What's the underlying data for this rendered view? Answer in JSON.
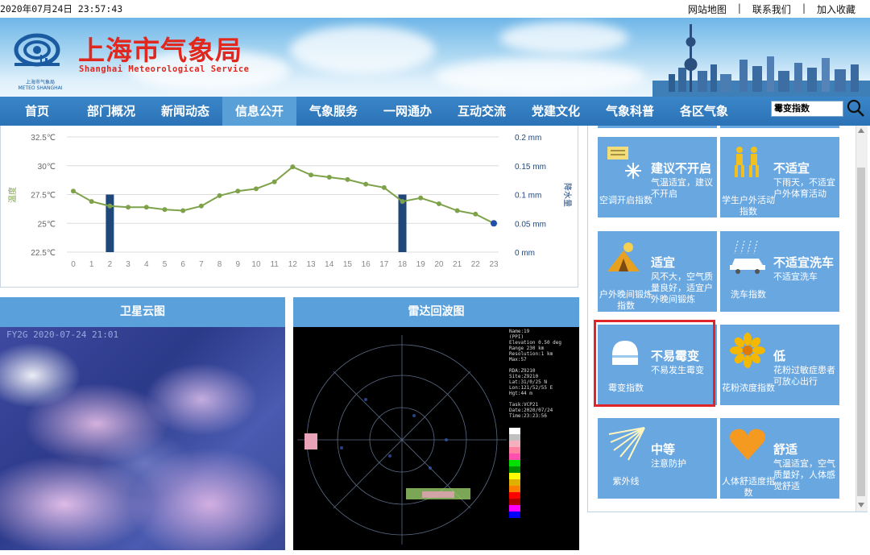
{
  "datetime": "2020年07月24日 23:57:43",
  "top_links": [
    "网站地图",
    "联系我们",
    "加入收藏"
  ],
  "site": {
    "title_cn": "上海市气象局",
    "title_en": "Shanghai Meteorological Service",
    "logo_caption": "上海市气象局\nMETEO SHANGHAI"
  },
  "nav": [
    "首页",
    "部门概况",
    "新闻动态",
    "信息公开",
    "气象服务",
    "一网通办",
    "互动交流",
    "党建文化",
    "气象科普",
    "各区气象"
  ],
  "nav_active": "信息公开",
  "search": {
    "value": "霉变指数"
  },
  "chart_data": {
    "type": "line+bar",
    "x": [
      0,
      1,
      2,
      3,
      4,
      5,
      6,
      7,
      8,
      9,
      10,
      11,
      12,
      13,
      14,
      15,
      16,
      17,
      18,
      19,
      20,
      21,
      22,
      23
    ],
    "left_axis": {
      "label": "温度",
      "ticks": [
        "22.5℃",
        "25℃",
        "27.5℃",
        "30℃",
        "32.5℃"
      ],
      "range": [
        22.5,
        32.5
      ]
    },
    "right_axis": {
      "label": "降水量",
      "ticks": [
        "0 mm",
        "0.05 mm",
        "0.1 mm",
        "0.15 mm",
        "0.2 mm"
      ],
      "range": [
        0,
        0.2
      ]
    },
    "temperature": [
      27.8,
      26.9,
      26.5,
      26.4,
      26.4,
      26.2,
      26.1,
      26.5,
      27.4,
      27.8,
      28.0,
      28.6,
      29.9,
      29.2,
      29.0,
      28.8,
      28.4,
      28.1,
      26.9,
      27.2,
      26.7,
      26.1,
      25.8,
      25.0
    ],
    "precipitation": [
      0,
      0,
      0.1,
      0,
      0,
      0,
      0,
      0,
      0,
      0,
      0,
      0,
      0,
      0,
      0,
      0,
      0,
      0,
      0.1,
      0,
      0,
      0,
      0,
      0
    ],
    "colors": {
      "line": "#7ea24a",
      "bar": "#1f477a",
      "last_point": "#1f4fa6"
    }
  },
  "panels": {
    "satellite": "卫星云图",
    "radar": "雷达回波图"
  },
  "satellite_stamp": "FY2G  2020-07-24 21:01",
  "radar_info": "Name:19\n(PPI)\nElevation 0.50 deg\nRange 230 km\nResolution:1 km\nMax:57\n\nRDA:Z9210\nSite:Z9210\nLat:31/0/25 N\nLon:121/52/55 E\nHgt:44 m\n\nTask:VCP21\nDate:2020/07/24\nTime:23:23:56",
  "indices": [
    {
      "icon": "ac-icon",
      "level": "建议不开启",
      "desc": "气温适宜，建议不开启",
      "name": "空调开启指数"
    },
    {
      "icon": "hikers-icon",
      "level": "不适宜",
      "desc": "下雨天，不适宜户外体育活动",
      "name": "学生户外活动指数"
    },
    {
      "icon": "tent-icon",
      "level": "适宜",
      "desc": "风不大，空气质量良好，适宜户外晚间锻炼",
      "name": "户外晚间锻炼指数"
    },
    {
      "icon": "car-wash-icon",
      "level": "不适宜洗车",
      "desc": "不适宜洗车",
      "name": "洗车指数"
    },
    {
      "icon": "bread-icon",
      "level": "不易霉变",
      "desc": "不易发生霉变",
      "name": "霉变指数"
    },
    {
      "icon": "flower-icon",
      "level": "低",
      "desc": "花粉过敏症患者可放心出行",
      "name": "花粉浓度指数"
    },
    {
      "icon": "sun-rays-icon",
      "level": "中等",
      "desc": "注意防护",
      "name": "紫外线"
    },
    {
      "icon": "heart-icon",
      "level": "舒适",
      "desc": "气温适宜，空气质量好，人体感觉舒适",
      "name": "人体舒适度指数"
    }
  ]
}
